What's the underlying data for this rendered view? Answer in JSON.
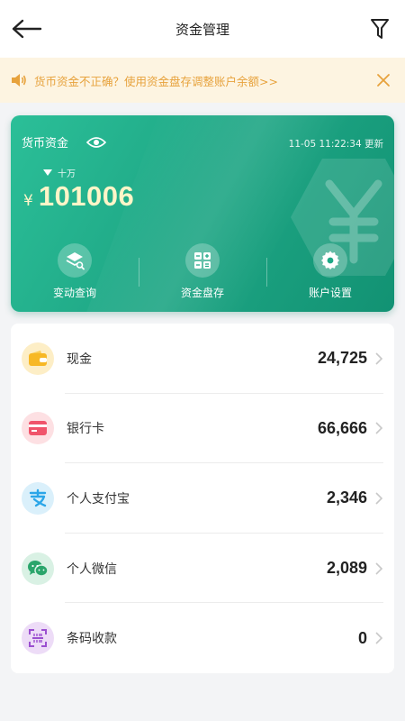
{
  "header": {
    "title": "资金管理"
  },
  "notice": {
    "text": "货币资金不正确？使用资金盘存调整账户余额>>"
  },
  "card": {
    "label": "货币资金",
    "updated": "11-05 11:22:34 更新",
    "unit": "十万",
    "currency": "¥",
    "amount": "101006",
    "actions": [
      {
        "label": "变动查询",
        "icon": "layers-search-icon"
      },
      {
        "label": "资金盘存",
        "icon": "grid-icon"
      },
      {
        "label": "账户设置",
        "icon": "gear-icon"
      }
    ]
  },
  "accounts": [
    {
      "name": "现金",
      "value": "24,725",
      "icon": "wallet-icon",
      "color": "#f7b825",
      "bg": "#fdeec6"
    },
    {
      "name": "银行卡",
      "value": "66,666",
      "icon": "bank-card-icon",
      "color": "#f0546b",
      "bg": "#fde0e3"
    },
    {
      "name": "个人支付宝",
      "value": "2,346",
      "icon": "alipay-icon",
      "color": "#2ba6e8",
      "bg": "#daf0fb"
    },
    {
      "name": "个人微信",
      "value": "2,089",
      "icon": "wechat-icon",
      "color": "#2aa56b",
      "bg": "#d9f1e4"
    },
    {
      "name": "条码收款",
      "value": "0",
      "icon": "barcode-scan-icon",
      "color": "#9b4fd0",
      "bg": "#eddcf7"
    }
  ]
}
